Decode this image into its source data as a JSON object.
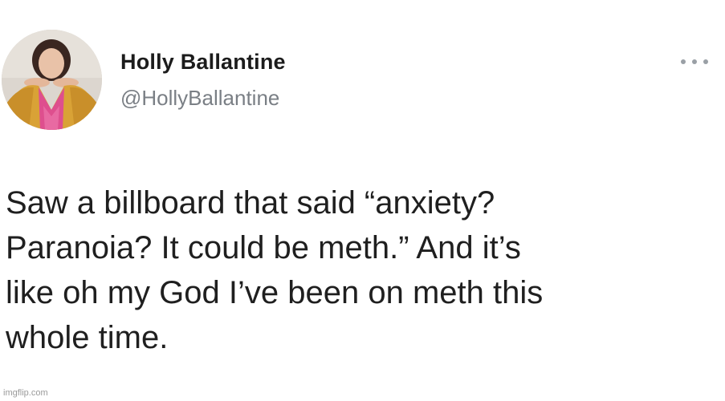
{
  "author": {
    "display_name": "Holly Ballantine",
    "handle": "@HollyBallantine"
  },
  "menu": {
    "icon": "more-horizontal-icon"
  },
  "tweet": {
    "lines": [
      "Saw a billboard that said “anxiety?",
      "Paranoia? It could be meth.” And it’s",
      "like oh my God I’ve been on meth this",
      "whole time."
    ]
  },
  "watermark": "imgflip.com",
  "colors": {
    "background": "#ffffff",
    "name": "#1c1c1c",
    "handle": "#7a7f85",
    "text": "#1f1f1f",
    "menu_dots": "#9aa0a6"
  }
}
